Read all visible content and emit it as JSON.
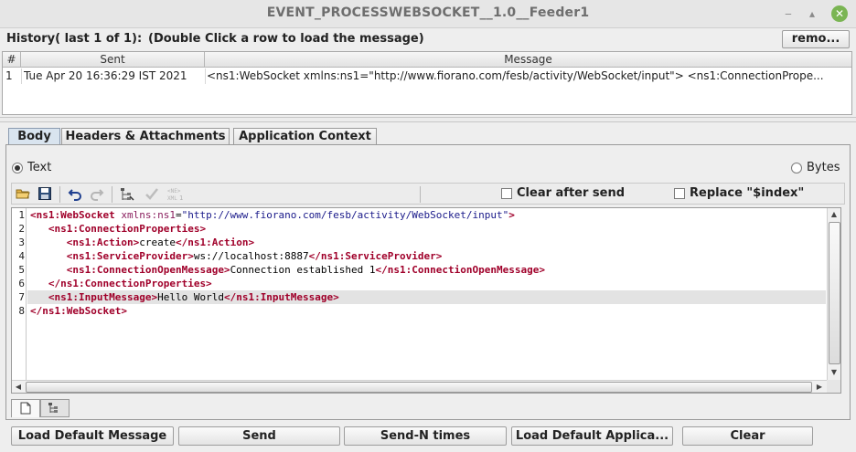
{
  "window": {
    "title": "EVENT_PROCESSWEBSOCKET__1.0__Feeder1",
    "min_glyph": "‒",
    "max_glyph": "▴",
    "close_glyph": "✕"
  },
  "history": {
    "label": "History( last 1 of 1):",
    "hint": "(Double Click a row to load the message)",
    "remove_label": "remo...",
    "columns": [
      "#",
      "Sent",
      "Message"
    ],
    "rows": [
      {
        "index": "1",
        "sent": "Tue Apr 20 16:36:29 IST 2021",
        "message": "<ns1:WebSocket xmlns:ns1=\"http://www.fiorano.com/fesb/activity/WebSocket/input\">    <ns1:ConnectionPrope..."
      }
    ]
  },
  "tabs": [
    {
      "label": "Body",
      "active": true
    },
    {
      "label": "Headers & Attachments",
      "active": false
    },
    {
      "label": "Application Context",
      "active": false
    }
  ],
  "format": {
    "text_label": "Text",
    "bytes_label": "Bytes",
    "selected": "Text"
  },
  "toolbar": {
    "icons": [
      "open-folder-icon",
      "save-icon",
      "undo-icon",
      "redo-icon",
      "tree-view-icon",
      "validate-check-icon",
      "xml-format-icon"
    ],
    "clear_after_send_label": "Clear after send",
    "replace_index_label": "Replace \"$index\""
  },
  "editor": {
    "lines": [
      {
        "n": "1",
        "indent": "",
        "open": "<ns1:WebSocket",
        "attr": " xmlns:ns1",
        "eq": "=",
        "val": "\"http://www.fiorano.com/fesb/activity/WebSocket/input\"",
        "close": ">"
      },
      {
        "n": "2",
        "indent": "   ",
        "open": "<ns1:ConnectionProperties>"
      },
      {
        "n": "3",
        "indent": "      ",
        "open": "<ns1:Action>",
        "text": "create",
        "end": "</ns1:Action>"
      },
      {
        "n": "4",
        "indent": "      ",
        "open": "<ns1:ServiceProvider>",
        "text": "ws://localhost:8887",
        "end": "</ns1:ServiceProvider>"
      },
      {
        "n": "5",
        "indent": "      ",
        "open": "<ns1:ConnectionOpenMessage>",
        "text": "Connection established 1",
        "end": "</ns1:ConnectionOpenMessage>"
      },
      {
        "n": "6",
        "indent": "   ",
        "open": "</ns1:ConnectionProperties>"
      },
      {
        "n": "7",
        "indent": "   ",
        "open": "<ns1:InputMessage>",
        "text": "Hello World",
        "end": "</ns1:InputMessage>"
      },
      {
        "n": "8",
        "indent": "",
        "open": "</ns1:WebSocket>"
      }
    ],
    "highlighted_line": "7"
  },
  "bottom_tabs": [
    "text-view-icon",
    "tree-view-icon"
  ],
  "actions": {
    "load_default_message": "Load Default Message",
    "send": "Send",
    "send_n_times": "Send-N times",
    "load_default_application": "Load Default Applica...",
    "clear": "Clear"
  },
  "colors": {
    "xml_tag": "#a0002a",
    "highlight_line": "#e3e3e3",
    "active_tab": "#d9e4ef",
    "close_button": "#7ab553"
  }
}
